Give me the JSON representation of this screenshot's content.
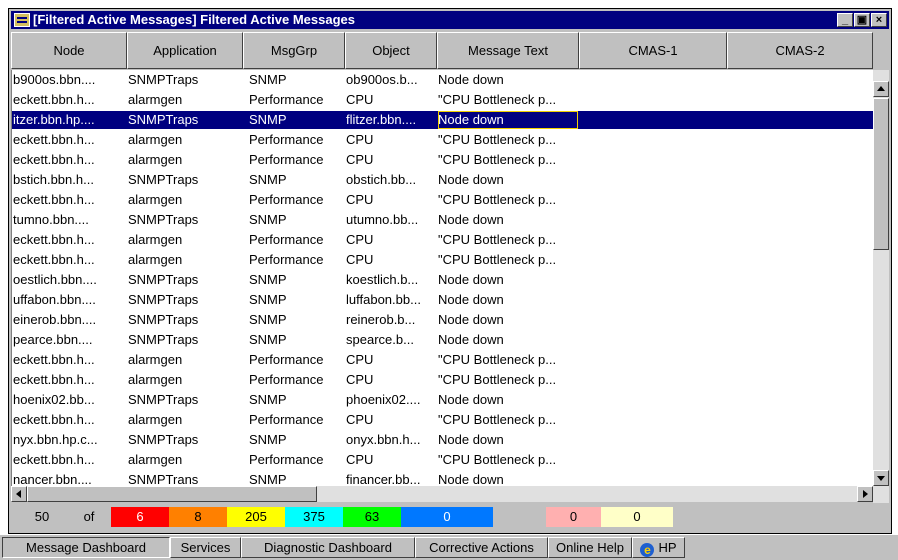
{
  "window": {
    "title": "[Filtered Active Messages] Filtered Active Messages",
    "controls": {
      "minimize": "_",
      "maximize": "▣",
      "close": "×"
    }
  },
  "columns": [
    "Node",
    "Application",
    "MsgGrp",
    "Object",
    "Message Text",
    "CMAS-1",
    "CMAS-2"
  ],
  "rows": [
    {
      "node": "b900os.bbn....",
      "app": "SNMPTraps",
      "grp": "SNMP",
      "obj": "ob900os.b...",
      "text": "Node down"
    },
    {
      "node": "eckett.bbn.h...",
      "app": "alarmgen",
      "grp": "Performance",
      "obj": "CPU",
      "text": "\"CPU Bottleneck p..."
    },
    {
      "node": "itzer.bbn.hp....",
      "app": "SNMPTraps",
      "grp": "SNMP",
      "obj": "flitzer.bbn....",
      "text": "Node down",
      "selected": true
    },
    {
      "node": "eckett.bbn.h...",
      "app": "alarmgen",
      "grp": "Performance",
      "obj": "CPU",
      "text": "\"CPU Bottleneck p..."
    },
    {
      "node": "eckett.bbn.h...",
      "app": "alarmgen",
      "grp": "Performance",
      "obj": "CPU",
      "text": "\"CPU Bottleneck p..."
    },
    {
      "node": "bstich.bbn.h...",
      "app": "SNMPTraps",
      "grp": "SNMP",
      "obj": "obstich.bb...",
      "text": "Node down"
    },
    {
      "node": "eckett.bbn.h...",
      "app": "alarmgen",
      "grp": "Performance",
      "obj": "CPU",
      "text": "\"CPU Bottleneck p..."
    },
    {
      "node": "tumno.bbn....",
      "app": "SNMPTraps",
      "grp": "SNMP",
      "obj": "utumno.bb...",
      "text": "Node down"
    },
    {
      "node": "eckett.bbn.h...",
      "app": "alarmgen",
      "grp": "Performance",
      "obj": "CPU",
      "text": "\"CPU Bottleneck p..."
    },
    {
      "node": "eckett.bbn.h...",
      "app": "alarmgen",
      "grp": "Performance",
      "obj": "CPU",
      "text": "\"CPU Bottleneck p..."
    },
    {
      "node": "oestlich.bbn....",
      "app": "SNMPTraps",
      "grp": "SNMP",
      "obj": "koestlich.b...",
      "text": "Node down"
    },
    {
      "node": "uffabon.bbn....",
      "app": "SNMPTraps",
      "grp": "SNMP",
      "obj": "luffabon.bb...",
      "text": "Node down"
    },
    {
      "node": "einerob.bbn....",
      "app": "SNMPTraps",
      "grp": "SNMP",
      "obj": "reinerob.b...",
      "text": "Node down"
    },
    {
      "node": "pearce.bbn....",
      "app": "SNMPTraps",
      "grp": "SNMP",
      "obj": "spearce.b...",
      "text": "Node down"
    },
    {
      "node": "eckett.bbn.h...",
      "app": "alarmgen",
      "grp": "Performance",
      "obj": "CPU",
      "text": "\"CPU Bottleneck p..."
    },
    {
      "node": "eckett.bbn.h...",
      "app": "alarmgen",
      "grp": "Performance",
      "obj": "CPU",
      "text": "\"CPU Bottleneck p..."
    },
    {
      "node": "hoenix02.bb...",
      "app": "SNMPTraps",
      "grp": "SNMP",
      "obj": "phoenix02....",
      "text": "Node down"
    },
    {
      "node": "eckett.bbn.h...",
      "app": "alarmgen",
      "grp": "Performance",
      "obj": "CPU",
      "text": "\"CPU Bottleneck p..."
    },
    {
      "node": "nyx.bbn.hp.c...",
      "app": "SNMPTraps",
      "grp": "SNMP",
      "obj": "onyx.bbn.h...",
      "text": "Node down"
    },
    {
      "node": "eckett.bbn.h...",
      "app": "alarmgen",
      "grp": "Performance",
      "obj": "CPU",
      "text": "\"CPU Bottleneck p..."
    },
    {
      "node": "nancer.bbn....",
      "app": "SNMPTrans",
      "grp": "SNMP",
      "obj": "financer.bb...",
      "text": "Node down"
    }
  ],
  "status": {
    "total": "50",
    "of_label": "of",
    "counts": [
      {
        "value": "6",
        "color": "#ff0000",
        "text_color": "#ffffff"
      },
      {
        "value": "8",
        "color": "#ff8000",
        "text_color": "#000000"
      },
      {
        "value": "205",
        "color": "#ffff00",
        "text_color": "#000000"
      },
      {
        "value": "375",
        "color": "#00ffff",
        "text_color": "#000000"
      },
      {
        "value": "63",
        "color": "#00ff00",
        "text_color": "#000000"
      },
      {
        "value": "0",
        "color": "#0078ff",
        "text_color": "#ffffff"
      },
      {
        "value": "",
        "color": "#c0c0c0",
        "text_color": "#000000"
      },
      {
        "value": "0",
        "color": "#ffb0b0",
        "text_color": "#000000"
      },
      {
        "value": "0",
        "color": "#ffffc8",
        "text_color": "#000000"
      }
    ]
  },
  "tabs": [
    "Message Dashboard",
    "Services",
    "Diagnostic Dashboard",
    "Corrective Actions",
    "Online Help",
    "HP"
  ],
  "colors": {
    "selection": "#000080",
    "title_bar": "#000080",
    "face": "#c0c0c0",
    "focus": "#f0d000"
  }
}
